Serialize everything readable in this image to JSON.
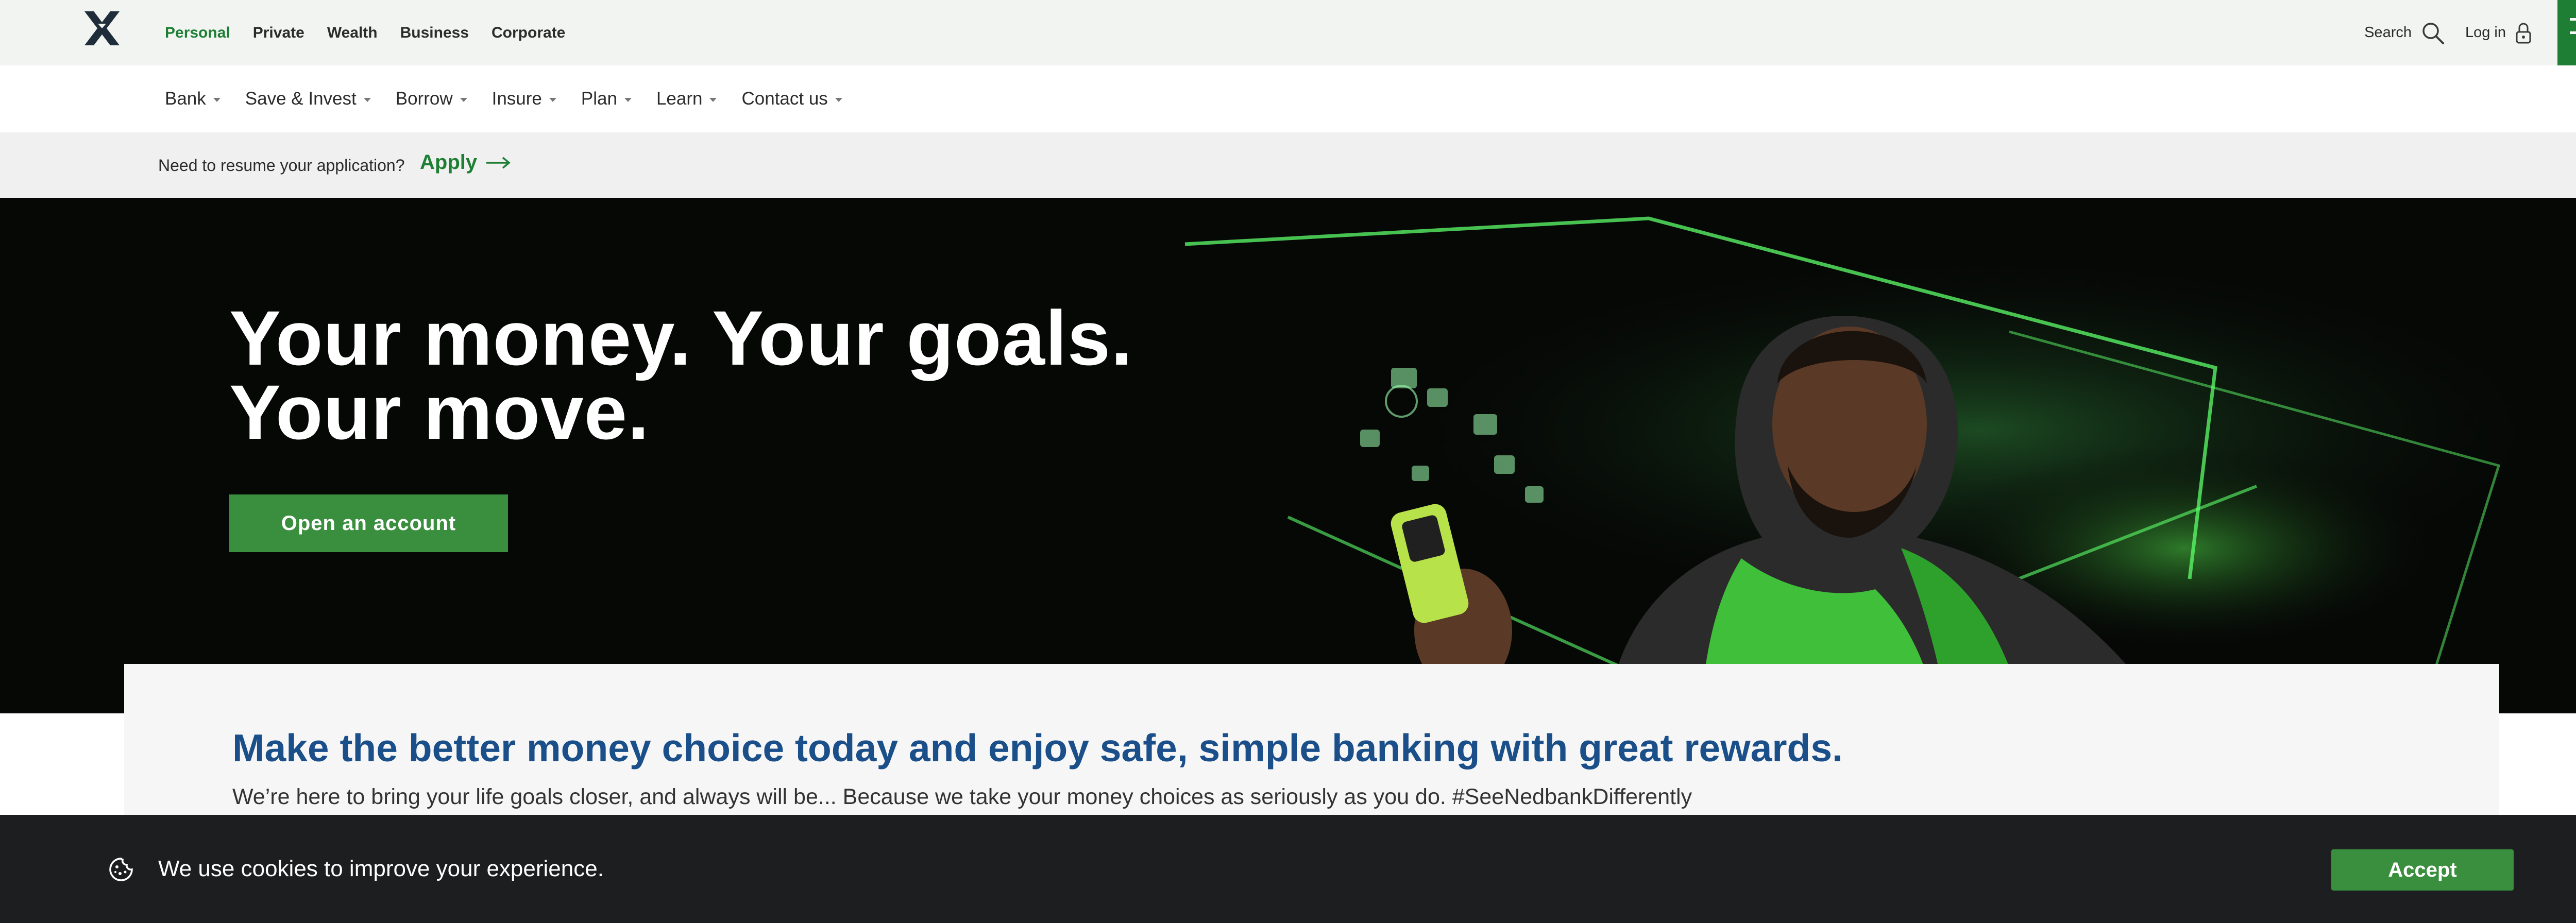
{
  "brand": {
    "logo_icon": "nedbank-x-logo-icon",
    "accent": "#1e7f34",
    "button_green": "#3a8f3e"
  },
  "segments": [
    {
      "label": "Personal",
      "active": true
    },
    {
      "label": "Private",
      "active": false
    },
    {
      "label": "Wealth",
      "active": false
    },
    {
      "label": "Business",
      "active": false
    },
    {
      "label": "Corporate",
      "active": false
    }
  ],
  "top_actions": {
    "search_label": "Search",
    "search_icon": "search-icon",
    "login_label": "Log in",
    "login_icon": "lock-icon",
    "menu_icon": "hamburger-menu-icon"
  },
  "nav": [
    {
      "label": "Bank"
    },
    {
      "label": "Save & Invest"
    },
    {
      "label": "Borrow"
    },
    {
      "label": "Insure"
    },
    {
      "label": "Plan"
    },
    {
      "label": "Learn"
    },
    {
      "label": "Contact us"
    }
  ],
  "notice": {
    "text": "Need to resume your application?",
    "link_label": "Apply",
    "link_icon": "arrow-right-icon",
    "close_icon": "close-icon"
  },
  "hero": {
    "title": "Your money. Your goals. Your move.",
    "cta_label": "Open an account"
  },
  "intro": {
    "title": "Make the better money choice today and enjoy safe, simple banking with great rewards.",
    "text": "We’re here to bring your life goals closer, and always will be... Because we take your money choices as seriously as you do. #SeeNedbankDifferently"
  },
  "cookie": {
    "icon": "cookie-icon",
    "text": "We use cookies to improve your experience.",
    "accept_label": "Accept"
  }
}
